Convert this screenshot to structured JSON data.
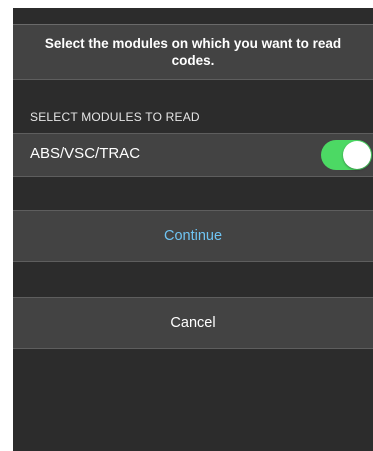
{
  "instruction": {
    "text": "Select the modules on which you want to read codes."
  },
  "modules_section": {
    "header": "SELECT MODULES TO READ",
    "items": [
      {
        "label": "ABS/VSC/TRAC",
        "enabled": true
      }
    ]
  },
  "actions": {
    "continue_label": "Continue",
    "cancel_label": "Cancel"
  },
  "colors": {
    "background": "#2c2c2c",
    "row_background": "#434343",
    "toggle_on": "#4cd964",
    "continue_text": "#6fc4f3",
    "text": "#ffffff"
  }
}
